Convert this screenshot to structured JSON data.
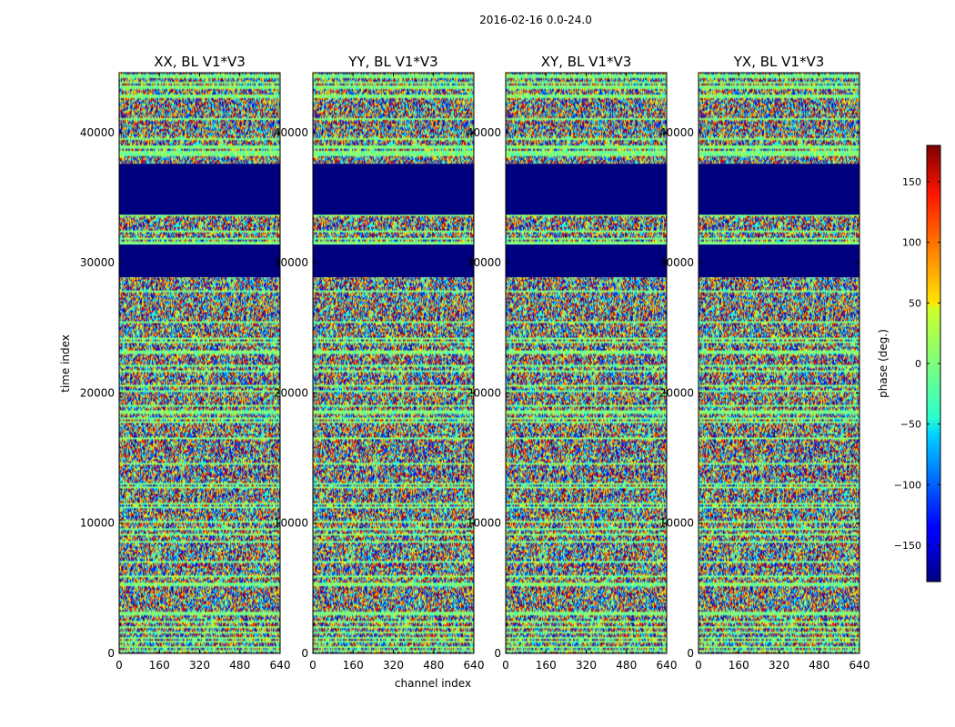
{
  "suptitle": "2016-02-16 0.0-24.0",
  "chart_data": {
    "type": "heatmap",
    "title": "2016-02-16 0.0-24.0",
    "xlabel": "channel index",
    "ylabel": "time index",
    "xlim": [
      0,
      640
    ],
    "ylim": [
      0,
      44600
    ],
    "x_ticks": [
      "0",
      "160",
      "320",
      "480",
      "640"
    ],
    "y_ticks": [
      "0",
      "10000",
      "20000",
      "30000",
      "40000"
    ],
    "panels": [
      {
        "title": "XX, BL V1*V3",
        "polarization": "XX"
      },
      {
        "title": "YY, BL V1*V3",
        "polarization": "YY"
      },
      {
        "title": "XY, BL V1*V3",
        "polarization": "XY"
      },
      {
        "title": "YX, BL V1*V3",
        "polarization": "YX"
      }
    ],
    "flagged_time_ranges": [
      [
        28900,
        31400
      ],
      [
        33700,
        37600
      ]
    ],
    "colorbar": {
      "label": "phase (deg.)",
      "range": [
        -180,
        180
      ],
      "ticks": [
        "150",
        "100",
        "50",
        "0",
        "−50",
        "−100",
        "−150"
      ],
      "colormap": "jet"
    }
  }
}
